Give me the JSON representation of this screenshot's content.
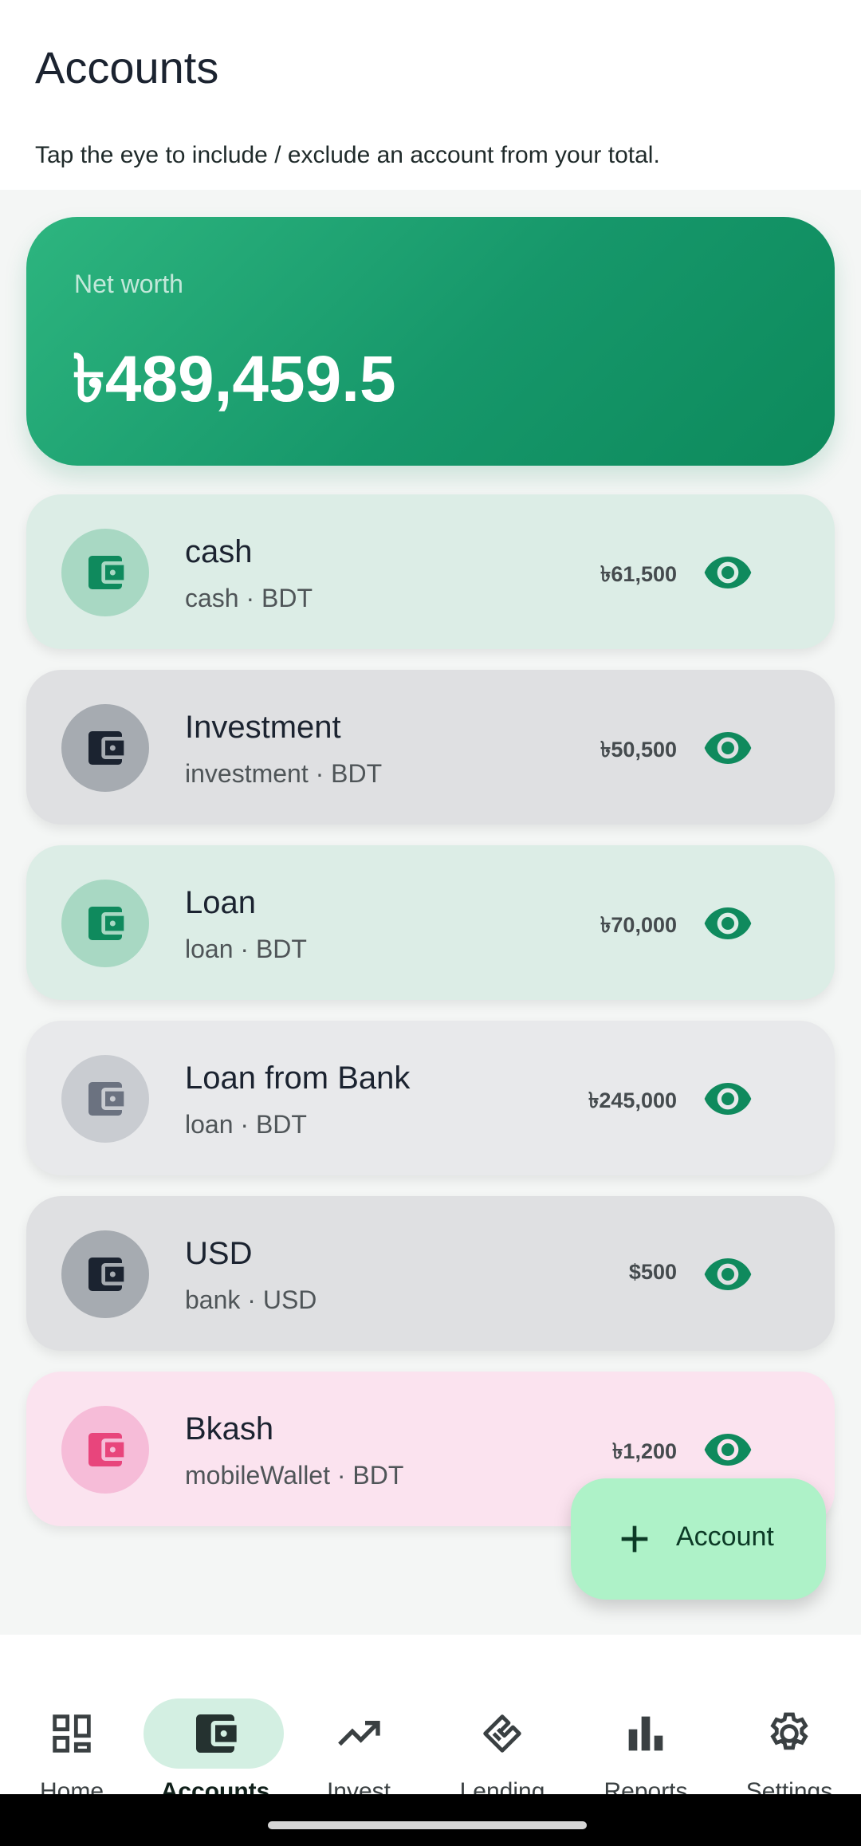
{
  "header": {
    "title": "Accounts",
    "subtitle": "Tap the eye to include / exclude an account from your total."
  },
  "networth": {
    "label": "Net worth",
    "value": "৳489,459.5"
  },
  "accounts": [
    {
      "name": "cash",
      "sub": "cash · BDT",
      "balance": "৳61,500",
      "style": "green",
      "icon": "wallet-icon",
      "visible": true
    },
    {
      "name": "Investment",
      "sub": "investment · BDT",
      "balance": "৳50,500",
      "style": "gray",
      "icon": "wallet-icon",
      "visible": true
    },
    {
      "name": "Loan",
      "sub": "loan · BDT",
      "balance": "৳70,000",
      "style": "green",
      "icon": "wallet-icon",
      "visible": true
    },
    {
      "name": "Loan from Bank",
      "sub": "loan · BDT",
      "balance": "৳245,000",
      "style": "light",
      "icon": "wallet-icon",
      "visible": true
    },
    {
      "name": "USD",
      "sub": "bank · USD",
      "balance": "$500",
      "style": "gray",
      "icon": "wallet-icon",
      "visible": true
    },
    {
      "name": "Bkash",
      "sub": "mobileWallet · BDT",
      "balance": "৳1,200",
      "style": "pink",
      "icon": "wallet-icon",
      "visible": true
    }
  ],
  "fab": {
    "label": "Account",
    "icon": "plus-icon"
  },
  "nav": [
    {
      "label": "Home",
      "icon": "dashboard-icon",
      "active": false
    },
    {
      "label": "Accounts",
      "icon": "wallet-icon",
      "active": true
    },
    {
      "label": "Invest",
      "icon": "trending-up-icon",
      "active": false
    },
    {
      "label": "Lending",
      "icon": "handshake-icon",
      "active": false
    },
    {
      "label": "Reports",
      "icon": "bar-chart-icon",
      "active": false
    },
    {
      "label": "Settings",
      "icon": "gear-icon",
      "active": false
    }
  ],
  "colors": {
    "accent": "#0f8a5d",
    "networth_gradient_start": "#2db57f",
    "networth_gradient_end": "#0d8a5c",
    "fab_bg": "#aef2c8",
    "active_nav_pill": "#d3efe2"
  }
}
